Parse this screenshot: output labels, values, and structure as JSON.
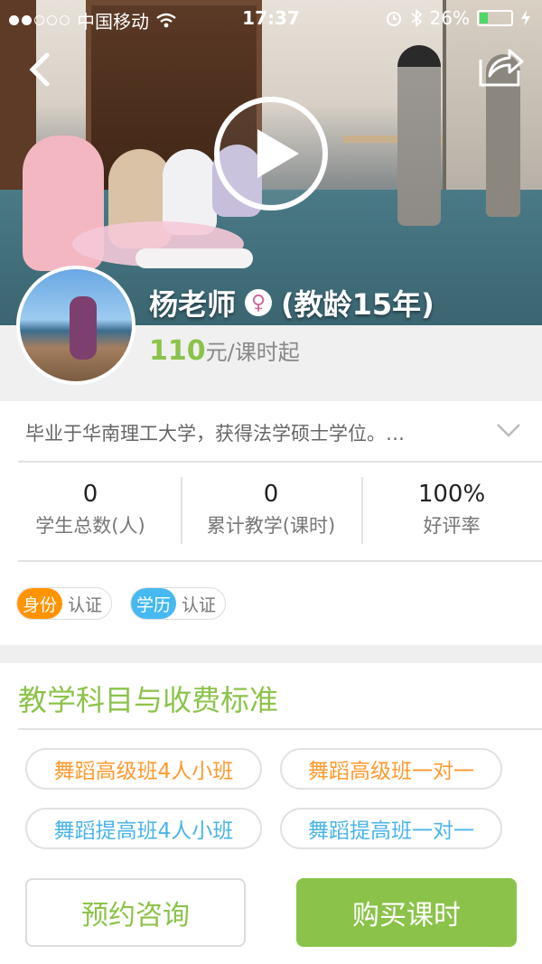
{
  "status_bar": {
    "carrier": "中国移动",
    "time": "17:37",
    "battery": "26%",
    "signal_dots_filled": 2,
    "signal_dots_total": 5
  },
  "header": {
    "back_icon": "chevron-left-icon",
    "share_icon": "share-icon",
    "play_icon": "play-icon"
  },
  "teacher": {
    "name": "杨老师",
    "gender_symbol": "♀",
    "experience": "(教龄15年)",
    "price_value": "110",
    "price_unit": "元/课时起"
  },
  "intro": {
    "text": "毕业于华南理工大学，获得法学硕士学位。…"
  },
  "stats": [
    {
      "value": "0",
      "label": "学生总数(人)"
    },
    {
      "value": "0",
      "label": "累计教学(课时)"
    },
    {
      "value": "100%",
      "label": "好评率"
    }
  ],
  "badges": [
    {
      "tag": "身份",
      "text": "认证",
      "color": "#ff9400"
    },
    {
      "tag": "学历",
      "text": "认证",
      "color": "#46b9f0"
    }
  ],
  "section": {
    "title": "教学科目与收费标准"
  },
  "subjects": [
    {
      "label": "舞蹈高级班4人小班"
    },
    {
      "label": "舞蹈高级班一对一"
    },
    {
      "label": "舞蹈提高班4人小班"
    },
    {
      "label": "舞蹈提高班一对一"
    }
  ],
  "actions": {
    "consult": "预约咨询",
    "buy": "购买课时"
  },
  "colors": {
    "accent_green": "#8bc34a",
    "orange": "#ff9a2e",
    "blue": "#4ab4e8"
  }
}
